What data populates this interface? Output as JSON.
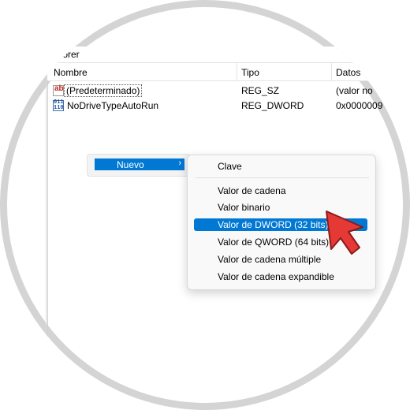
{
  "path": {
    "text": "plorer"
  },
  "columns": {
    "name": "Nombre",
    "type": "Tipo",
    "data": "Datos"
  },
  "rows": [
    {
      "icon": "string-value-icon",
      "icon_text": "ab",
      "name": "(Predeterminado)",
      "type": "REG_SZ",
      "data": "(valor no"
    },
    {
      "icon": "binary-value-icon",
      "icon_text": "011\n110",
      "name": "NoDriveTypeAutoRun",
      "type": "REG_DWORD",
      "data": "0x0000009"
    }
  ],
  "context_menu": {
    "nuevo_label": "Nuevo",
    "arrow": "›"
  },
  "submenu": {
    "items": [
      {
        "label": "Clave"
      },
      {
        "label": "Valor de cadena"
      },
      {
        "label": "Valor binario"
      },
      {
        "label": "Valor de DWORD (32 bits)",
        "selected": true
      },
      {
        "label": "Valor de QWORD (64 bits)"
      },
      {
        "label": "Valor de cadena múltiple"
      },
      {
        "label": "Valor de cadena expandible"
      }
    ]
  },
  "colors": {
    "accent": "#0078d4",
    "pointer": "#e53935"
  }
}
